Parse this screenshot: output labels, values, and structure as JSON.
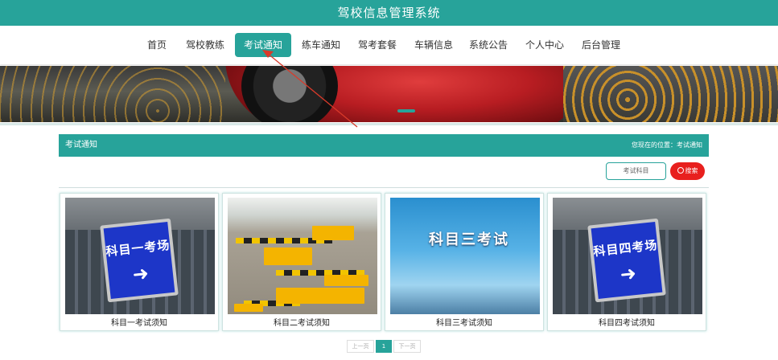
{
  "header": {
    "title": "驾校信息管理系统"
  },
  "nav": {
    "items": [
      {
        "label": "首页"
      },
      {
        "label": "驾校教练"
      },
      {
        "label": "考试通知",
        "active": true
      },
      {
        "label": "练车通知"
      },
      {
        "label": "驾考套餐"
      },
      {
        "label": "车辆信息"
      },
      {
        "label": "系统公告"
      },
      {
        "label": "个人中心"
      },
      {
        "label": "后台管理"
      }
    ]
  },
  "section": {
    "title": "考试通知",
    "breadcrumb": "您现在的位置：考试通知"
  },
  "search": {
    "placeholder": "考试科目",
    "button_label": "搜索"
  },
  "cards": [
    {
      "caption": "科目一考试须知",
      "sign_text": "科目一考场"
    },
    {
      "caption": "科目二考试须知"
    },
    {
      "caption": "科目三考试须知",
      "image_text": "科目三考试"
    },
    {
      "caption": "科目四考试须知",
      "sign_text": "科目四考场"
    }
  ],
  "pagination": {
    "prev": "上一页",
    "current": "1",
    "next": "下一页"
  },
  "colors": {
    "accent": "#27a39a",
    "danger": "#e8201e"
  }
}
